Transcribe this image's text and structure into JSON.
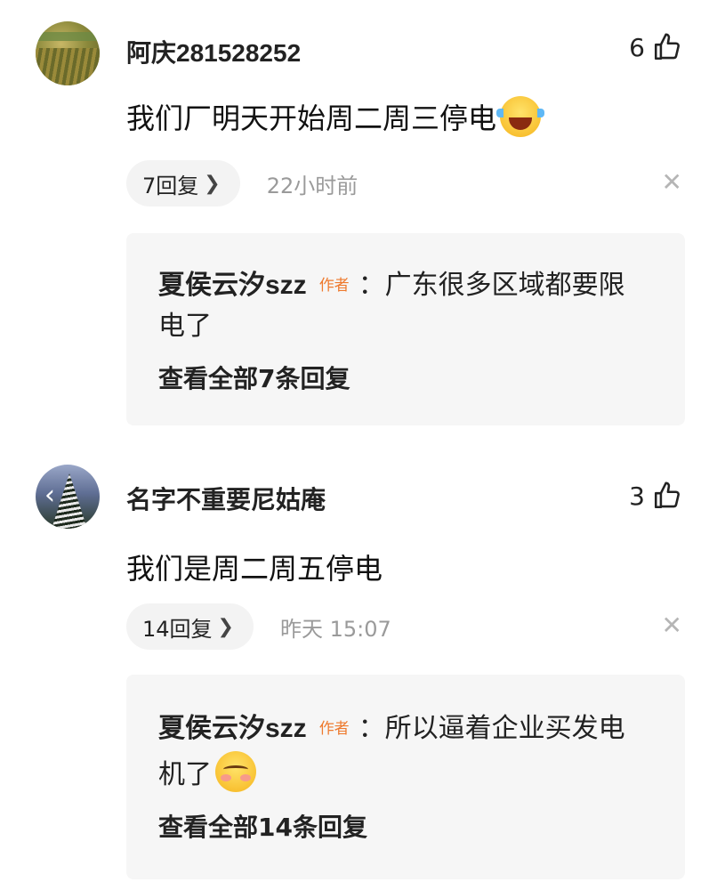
{
  "comments": [
    {
      "username": "阿庆281528252",
      "likes": "6",
      "text": "我们厂明天开始周二周三停电",
      "emoji": "laughing-crying-emoji",
      "reply_count_label": "7回复",
      "time": "22小时前",
      "reply_preview": {
        "author": "夏侯云汐szz",
        "badge": "作者",
        "text_line1": "：广东很多区域都要限",
        "text_line2": "电了",
        "view_all": "查看全部7条回复"
      }
    },
    {
      "username": "名字不重要尼姑庵",
      "likes": "3",
      "text": "我们是周二周五停电",
      "reply_count_label": "14回复",
      "time": "昨天  15:07",
      "reply_preview": {
        "author": "夏侯云汐szz",
        "badge": "作者",
        "text_line1": "：所以逼着企业买发电",
        "text_line2": "机了",
        "emoji": "shy-smile-emoji",
        "view_all": "查看全部14条回复"
      }
    }
  ],
  "icons": {
    "like": "thumbs-up-icon",
    "chevron": "chevron-right-icon",
    "close": "close-icon"
  },
  "colors": {
    "author_badge": "#ee7a2e",
    "time": "#9a9a9a",
    "reply_bg": "#f6f6f6"
  }
}
